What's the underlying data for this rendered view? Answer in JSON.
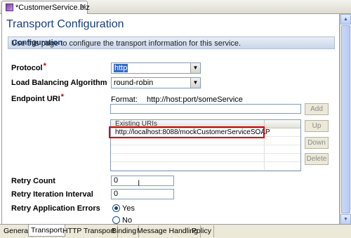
{
  "editor_tab": {
    "title": "*CustomerService.biz",
    "close": "✕"
  },
  "page_title": "Transport Configuration",
  "section": {
    "title": "Configuration",
    "description": "Use this page to configure the transport information for this service."
  },
  "protocol": {
    "label": "Protocol",
    "required": "*",
    "value": "http"
  },
  "load_balancing": {
    "label": "Load Balancing Algorithm",
    "value": "round-robin"
  },
  "endpoint": {
    "label": "Endpoint URI",
    "required": "*",
    "format_label": "Format:",
    "format_value": "http://host:port/someService",
    "input_value": "",
    "add_button": "Add",
    "up_button": "Up",
    "down_button": "Down",
    "delete_button": "Delete",
    "table_header": "Existing URIs",
    "uris": [
      "http://localhost:8088/mockCustomerServiceSOAP"
    ]
  },
  "retry_count": {
    "label": "Retry Count",
    "value": "0"
  },
  "retry_interval": {
    "label": "Retry Iteration Interval",
    "value": "0"
  },
  "retry_app_errors": {
    "label": "Retry Application Errors",
    "options": [
      {
        "label": "Yes",
        "selected": true
      },
      {
        "label": "No",
        "selected": false
      }
    ]
  },
  "bottom_tabs": [
    "General",
    "Transport",
    "HTTP Transport",
    "Binding",
    "Message Handling",
    "Policy"
  ],
  "active_bottom_tab": "Transport",
  "colors": {
    "title_blue": "#16407e",
    "required_red": "#d00000",
    "highlight_red": "#d50000"
  }
}
